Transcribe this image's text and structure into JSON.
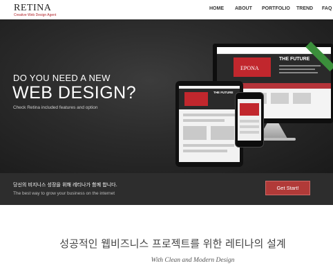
{
  "logo": {
    "title": "RETINA",
    "subtitle": "Creative Web Design Agent"
  },
  "nav": {
    "items": [
      {
        "label": "HOME"
      },
      {
        "label": "ABOUT"
      },
      {
        "label": "PORTFOLIO"
      },
      {
        "label": "TREND"
      },
      {
        "label": "FAQ"
      }
    ]
  },
  "hero": {
    "kicker": "DO YOU NEED A NEW",
    "title": "WEB DESIGN?",
    "description": "Check Retina included features and option",
    "mockup": {
      "brand": "EPONA",
      "heading": "THE FUTURE"
    }
  },
  "cta": {
    "korean": "당신의 비지니스 성장을 위해 레티나가 함께 합니다.",
    "english": "The best way to grow your business on the internet",
    "button_label": "Get Start!"
  },
  "intro": {
    "heading": "성공적인 웹비즈니스 프로젝트를 위한 레티나의 설계",
    "subheading": "With Clean and Modern Design"
  },
  "colors": {
    "accent": "#b13a38",
    "hero_bg": "#2b2b2b",
    "ribbon": "#3b8f3b"
  }
}
